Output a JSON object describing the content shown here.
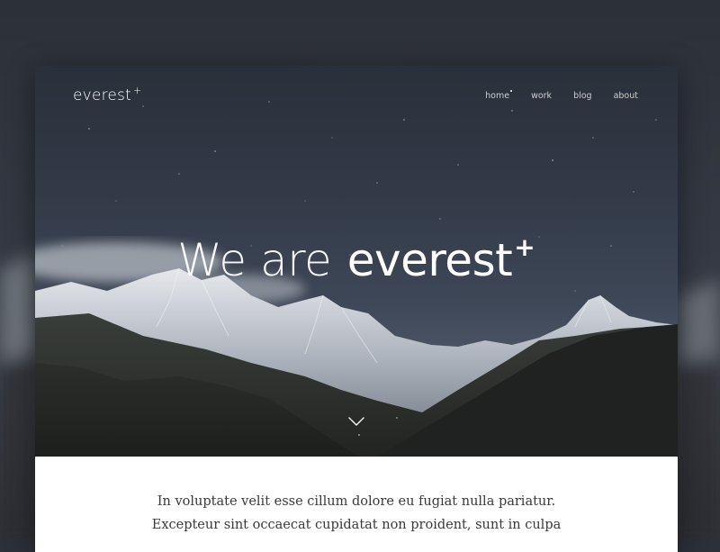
{
  "site": {
    "logo_text": "everest",
    "logo_sup": "+"
  },
  "nav": {
    "items": [
      {
        "label": "home",
        "active": true
      },
      {
        "label": "work",
        "active": false
      },
      {
        "label": "blog",
        "active": false
      },
      {
        "label": "about",
        "active": false
      }
    ]
  },
  "hero": {
    "headline_light": "We are",
    "headline_bold": "everest",
    "headline_sup": "+",
    "scroll_icon": "chevron-down-icon"
  },
  "content": {
    "line1": "In voluptate velit esse cillum dolore eu fugiat nulla pariatur.",
    "line2": "Excepteur sint occaecat cupidatat non proident, sunt in culpa"
  },
  "colors": {
    "background": "#33373f",
    "hero_sky": "#323a48",
    "text_white": "#ffffff",
    "body_text": "#3a3a3a"
  }
}
